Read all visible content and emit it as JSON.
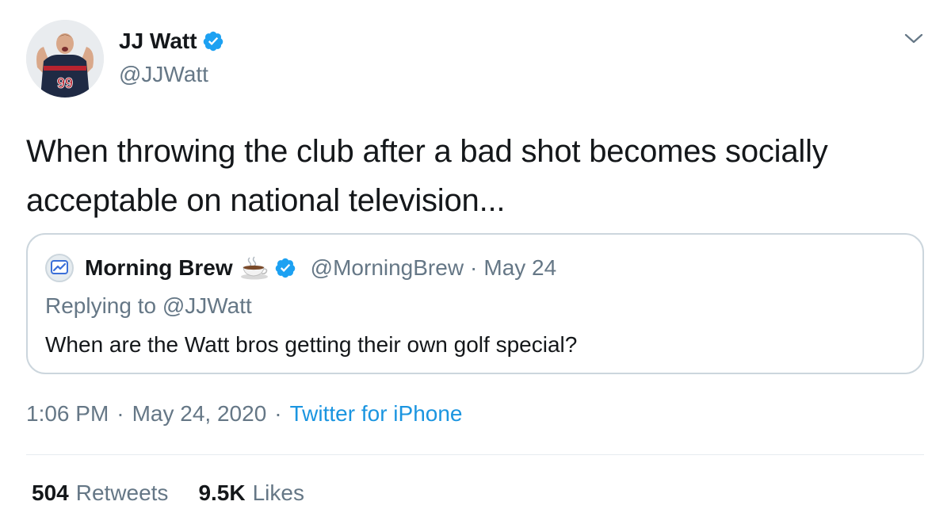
{
  "author": {
    "display_name": "JJ Watt",
    "handle": "@JJWatt",
    "avatar_icon": "profile-photo",
    "jersey_number": "99",
    "verified": true
  },
  "tweet": {
    "text": "When throwing the club after a bad shot becomes socially acceptable on national television..."
  },
  "quoted_tweet": {
    "display_name": "Morning Brew",
    "emoji_icon": "coffee-cup-icon",
    "handle": "@MorningBrew",
    "separator": "·",
    "date": "May 24",
    "replying_to": "Replying to @JJWatt",
    "text": "When are the Watt bros getting their own golf special?"
  },
  "meta": {
    "time": "1:06 PM",
    "date": "May 24, 2020",
    "separator": "·",
    "source": "Twitter for iPhone"
  },
  "stats": {
    "retweets_count": "504",
    "retweets_label": "Retweets",
    "likes_count": "9.5K",
    "likes_label": "Likes"
  },
  "colors": {
    "text_primary": "#14171a",
    "text_secondary": "#657786",
    "link": "#1b95e0",
    "verified": "#1da1f2",
    "border": "#ccd6dd"
  }
}
